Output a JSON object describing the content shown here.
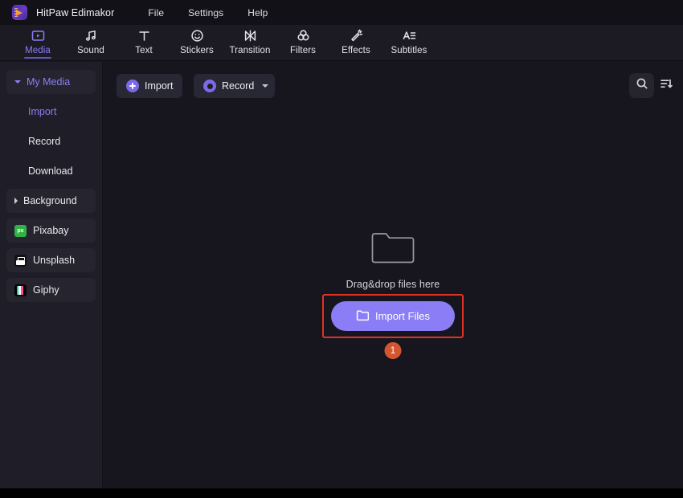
{
  "titlebar": {
    "logo_icon": "hitpaw-logo-icon",
    "app_title": "HitPaw Edimakor",
    "menu": [
      {
        "label": "File"
      },
      {
        "label": "Settings"
      },
      {
        "label": "Help"
      }
    ]
  },
  "toolbar": {
    "active": "Media",
    "accent_color": "#8b7df5",
    "tabs": [
      {
        "label": "Media",
        "icon": "media-icon"
      },
      {
        "label": "Sound",
        "icon": "music-note-icon"
      },
      {
        "label": "Text",
        "icon": "text-t-icon"
      },
      {
        "label": "Stickers",
        "icon": "smiley-face-icon"
      },
      {
        "label": "Transition",
        "icon": "transition-bowtie-icon"
      },
      {
        "label": "Filters",
        "icon": "filters-circles-icon"
      },
      {
        "label": "Effects",
        "icon": "magic-wand-icon"
      },
      {
        "label": "Subtitles",
        "icon": "subtitles-a-lines-icon"
      }
    ]
  },
  "sidebar": {
    "items": [
      {
        "label": "My Media",
        "type": "group",
        "state": "expanded",
        "selected": true,
        "icon": "caret-down-icon"
      },
      {
        "label": "Import",
        "type": "sub",
        "selected": true
      },
      {
        "label": "Record",
        "type": "sub",
        "selected": false
      },
      {
        "label": "Download",
        "type": "sub",
        "selected": false
      },
      {
        "label": "Background",
        "type": "group",
        "state": "collapsed",
        "selected": false,
        "icon": "caret-right-icon"
      },
      {
        "label": "Pixabay",
        "type": "service",
        "icon": "pixabay-icon"
      },
      {
        "label": "Unsplash",
        "type": "service",
        "icon": "unsplash-icon"
      },
      {
        "label": "Giphy",
        "type": "service",
        "icon": "giphy-icon"
      }
    ]
  },
  "actionbar": {
    "import_label": "Import",
    "import_icon": "plus-circle-icon",
    "record_label": "Record",
    "record_icon": "record-circle-icon",
    "record_dropdown_icon": "chevron-down-icon",
    "search_icon": "search-icon",
    "sort_icon": "sort-descending-icon"
  },
  "dropzone": {
    "folder_icon": "folder-icon",
    "hint_text": "Drag&drop files here",
    "import_files_label": "Import Files",
    "import_files_icon": "folder-open-icon",
    "button_color": "#8b7df5",
    "highlight_color": "#e03223",
    "badge_text": "1",
    "badge_color": "#d4552f"
  }
}
